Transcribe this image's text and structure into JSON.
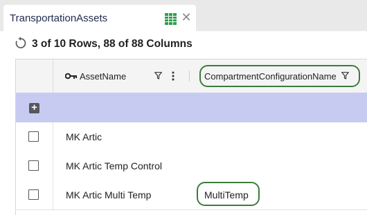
{
  "tab": {
    "title": "TransportationAssets",
    "grid_icon": "table-grid-icon",
    "close_icon": "close-icon",
    "close_glyph": "✕"
  },
  "toolbar": {
    "refresh_icon": "refresh-icon",
    "summary": "3 of 10 Rows, 88 of 88 Columns"
  },
  "columns": [
    {
      "label": "AssetName",
      "icon": "key-icon",
      "filter": true,
      "menu": true
    },
    {
      "label": "CompartmentConfigurationName",
      "filter": true,
      "highlighted": true
    }
  ],
  "add_row": {
    "icon": "add-row-icon",
    "glyph": "+"
  },
  "rows": [
    {
      "asset_name": "MK Artic",
      "compartment": ""
    },
    {
      "asset_name": "MK Artic Temp Control",
      "compartment": ""
    },
    {
      "asset_name": "MK Artic Multi Temp",
      "compartment": "MultiTemp",
      "highlighted": true
    }
  ],
  "colors": {
    "highlight_outline": "#3d7a3a",
    "add_row_bg": "#c8cbf1",
    "grid_icon": "#2e9e4f"
  }
}
